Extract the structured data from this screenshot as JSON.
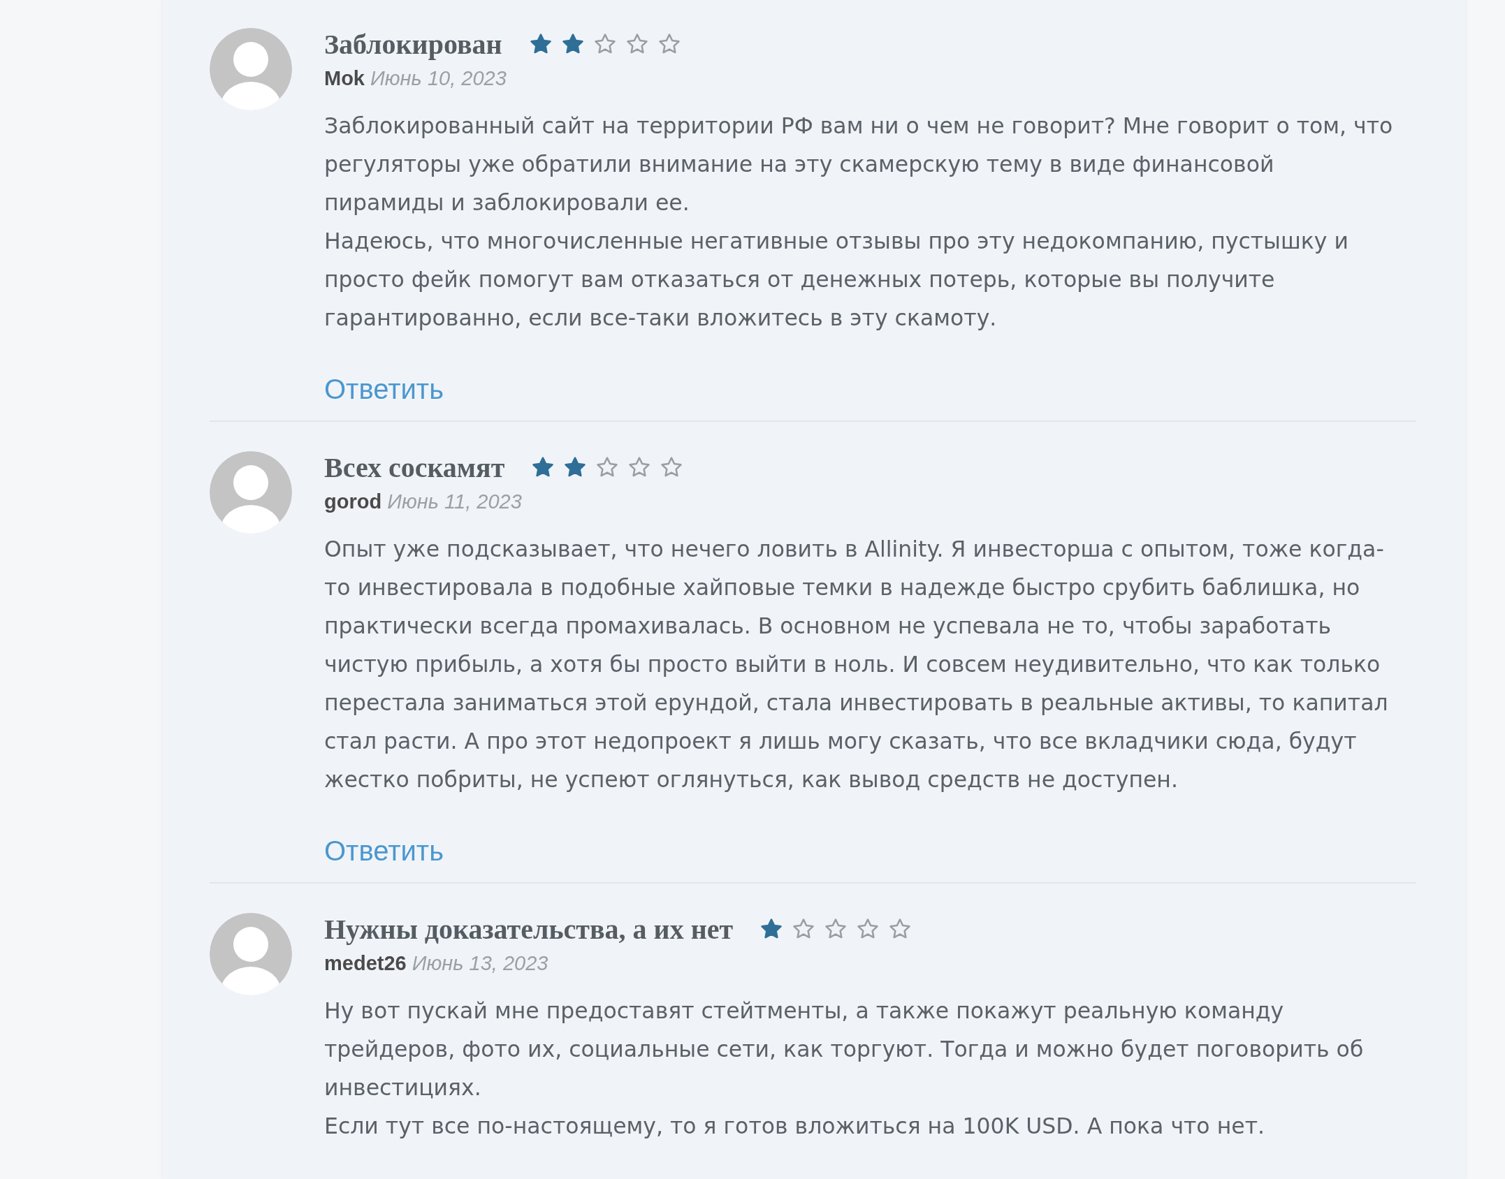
{
  "reviews": [
    {
      "title": "Заблокирован",
      "stars": 2,
      "author": "Mok",
      "date": "Июнь 10, 2023",
      "paragraphs": [
        "Заблокированный сайт на территории РФ вам ни о чем не говорит? Мне говорит о том, что регуляторы уже обратили внимание на эту скамерскую тему в виде финансовой пирамиды и заблокировали ее.",
        "Надеюсь, что многочисленные негативные отзывы про эту недокомпанию, пустышку и просто фейк помогут вам отказаться от денежных потерь, которые вы получите гарантированно, если все-таки вложитесь в эту скамоту."
      ],
      "reply": "Ответить"
    },
    {
      "title": "Всех соскамят",
      "stars": 2,
      "author": "gorod",
      "date": "Июнь 11, 2023",
      "paragraphs": [
        "Опыт уже подсказывает, что нечего ловить в Allinity. Я инвесторша с опытом, тоже когда-то инвестировала в подобные хайповые темки в надежде быстро срубить баблишка, но практически всегда промахивалась. В основном не успевала не то, чтобы заработать чистую прибыль, а хотя бы просто выйти в ноль. И совсем неудивительно, что как только перестала заниматься этой ерундой, стала инвестировать в реальные активы, то капитал стал расти. А про этот недопроект я лишь могу сказать, что все вкладчики сюда, будут жестко побриты, не успеют оглянуться, как вывод средств не доступен."
      ],
      "reply": "Ответить"
    },
    {
      "title": "Нужны доказательства, а их нет",
      "stars": 1,
      "author": "medet26",
      "date": "Июнь 13, 2023",
      "paragraphs": [
        "Ну вот пускай мне предоставят стейтменты, а также покажут реальную команду трейдеров, фото их, социальные сети, как торгуют. Тогда и можно будет поговорить об инвестициях.",
        "Если тут все по-настоящему, то я готов вложиться на 100K USD. А пока что нет."
      ]
    }
  ]
}
